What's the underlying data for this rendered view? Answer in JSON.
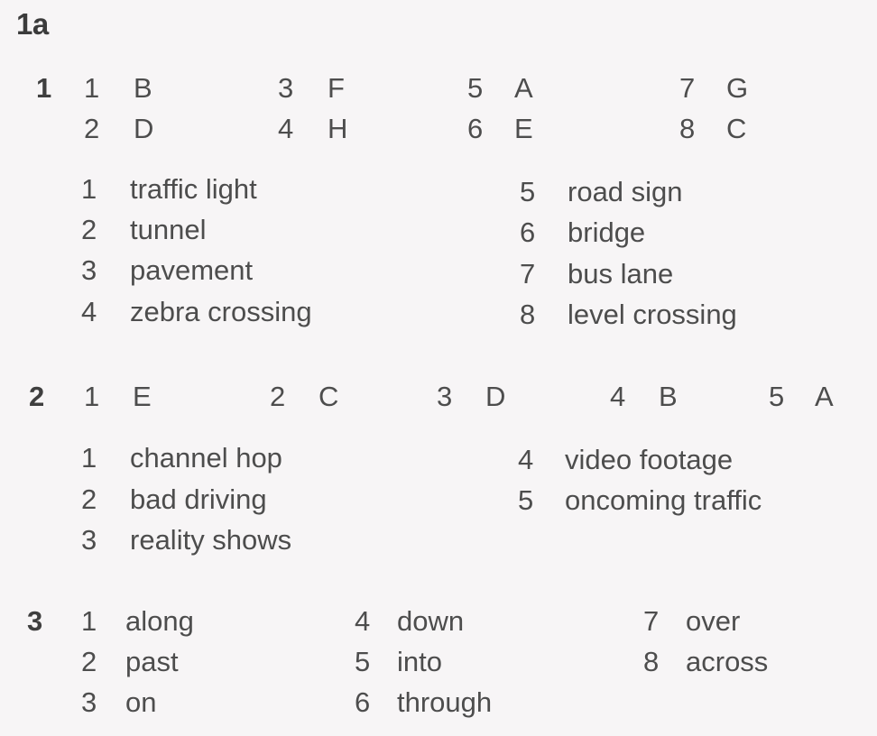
{
  "heading": "1a",
  "exercises": [
    {
      "number": "1",
      "answers": [
        {
          "item": "1",
          "answer": "B"
        },
        {
          "item": "2",
          "answer": "D"
        },
        {
          "item": "3",
          "answer": "F"
        },
        {
          "item": "4",
          "answer": "H"
        },
        {
          "item": "5",
          "answer": "A"
        },
        {
          "item": "6",
          "answer": "E"
        },
        {
          "item": "7",
          "answer": "G"
        },
        {
          "item": "8",
          "answer": "C"
        }
      ],
      "vocabulary": [
        {
          "item": "1",
          "word": "traffic light"
        },
        {
          "item": "2",
          "word": "tunnel"
        },
        {
          "item": "3",
          "word": "pavement"
        },
        {
          "item": "4",
          "word": "zebra crossing"
        },
        {
          "item": "5",
          "word": "road sign"
        },
        {
          "item": "6",
          "word": "bridge"
        },
        {
          "item": "7",
          "word": "bus lane"
        },
        {
          "item": "8",
          "word": "level crossing"
        }
      ]
    },
    {
      "number": "2",
      "answers": [
        {
          "item": "1",
          "answer": "E"
        },
        {
          "item": "2",
          "answer": "C"
        },
        {
          "item": "3",
          "answer": "D"
        },
        {
          "item": "4",
          "answer": "B"
        },
        {
          "item": "5",
          "answer": "A"
        }
      ],
      "vocabulary": [
        {
          "item": "1",
          "word": "channel hop"
        },
        {
          "item": "2",
          "word": "bad driving"
        },
        {
          "item": "3",
          "word": "reality shows"
        },
        {
          "item": "4",
          "word": "video footage"
        },
        {
          "item": "5",
          "word": "oncoming traffic"
        }
      ]
    },
    {
      "number": "3",
      "answers": [],
      "vocabulary": [
        {
          "item": "1",
          "word": "along"
        },
        {
          "item": "2",
          "word": "past"
        },
        {
          "item": "3",
          "word": "on"
        },
        {
          "item": "4",
          "word": "down"
        },
        {
          "item": "5",
          "word": "into"
        },
        {
          "item": "6",
          "word": "through"
        },
        {
          "item": "7",
          "word": "over"
        },
        {
          "item": "8",
          "word": "across"
        }
      ]
    }
  ]
}
